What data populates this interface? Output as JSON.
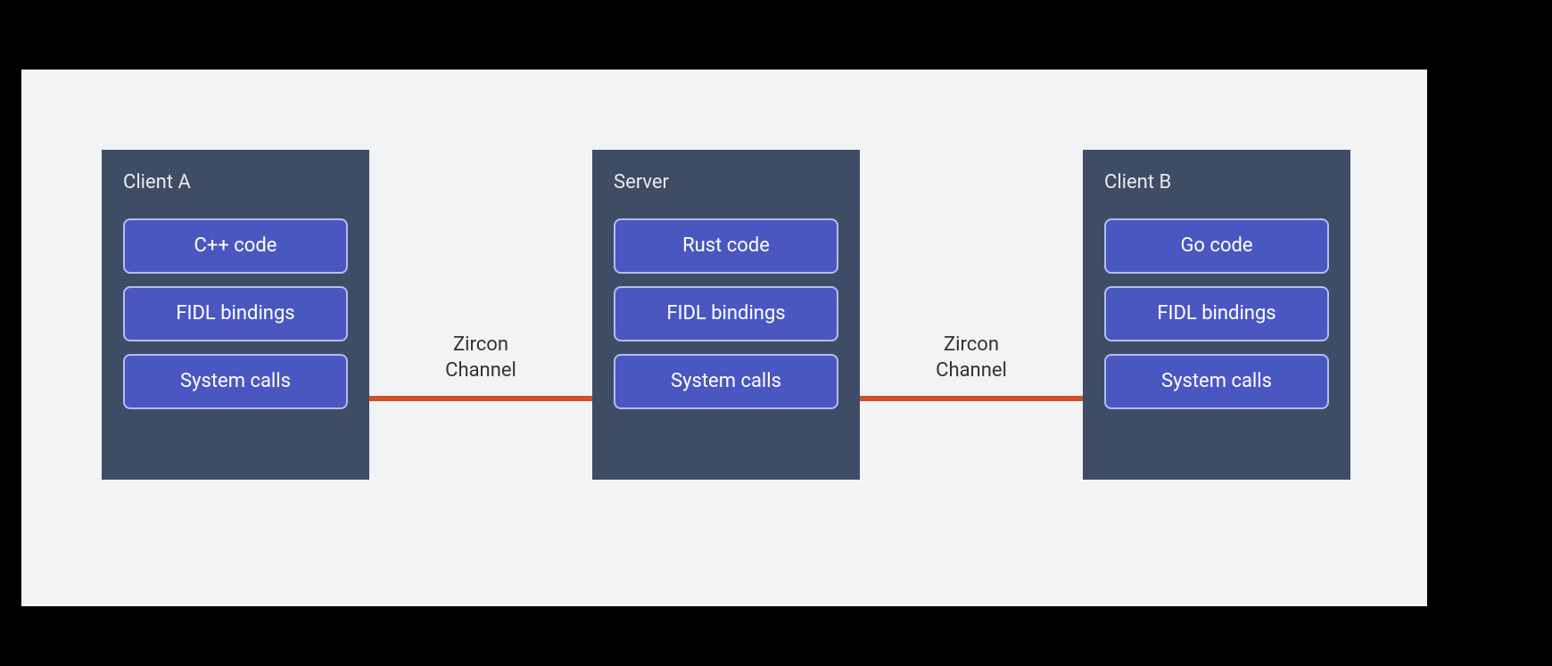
{
  "boxes": [
    {
      "title": "Client A",
      "layers": [
        "C++ code",
        "FIDL bindings",
        "System calls"
      ]
    },
    {
      "title": "Server",
      "layers": [
        "Rust code",
        "FIDL bindings",
        "System calls"
      ]
    },
    {
      "title": "Client B",
      "layers": [
        "Go code",
        "FIDL bindings",
        "System calls"
      ]
    }
  ],
  "connectors": [
    {
      "label_line1": "Zircon",
      "label_line2": "Channel"
    },
    {
      "label_line1": "Zircon",
      "label_line2": "Channel"
    }
  ]
}
